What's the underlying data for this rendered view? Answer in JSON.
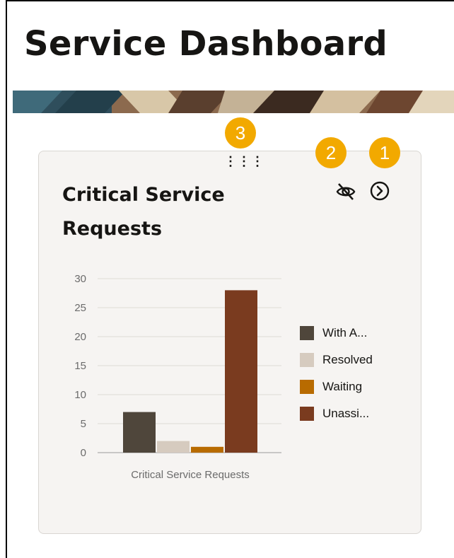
{
  "page": {
    "title": "Service Dashboard"
  },
  "card": {
    "title": "Critical Service Requests",
    "drag_handle_icon": "drag-handle-icon",
    "hide_icon": "eye-slash-icon",
    "open_icon": "chevron-right-circle-icon"
  },
  "callouts": {
    "one": "1",
    "two": "2",
    "three": "3",
    "color": "#f2a900"
  },
  "chart_data": {
    "type": "bar",
    "categories": [
      "Critical Service Requests"
    ],
    "series": [
      {
        "name": "With A...",
        "values": [
          7
        ],
        "color": "#4f463b"
      },
      {
        "name": "Resolved",
        "values": [
          2
        ],
        "color": "#d6cbbf"
      },
      {
        "name": "Waiting",
        "values": [
          1
        ],
        "color": "#b86b00"
      },
      {
        "name": "Unassi...",
        "values": [
          28
        ],
        "color": "#7a3b1f"
      }
    ],
    "ylim": [
      0,
      30
    ],
    "yticks": [
      "0",
      "5",
      "10",
      "15",
      "20",
      "25",
      "30"
    ],
    "grid": true,
    "legend_position": "right"
  }
}
